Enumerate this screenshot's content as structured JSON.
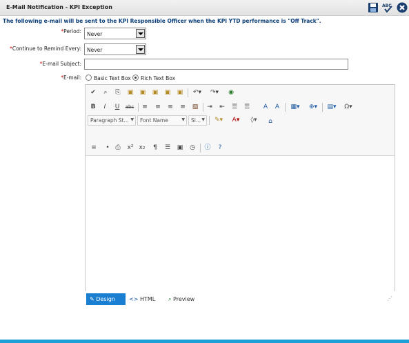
{
  "window": {
    "title": "E-Mail Notification - KPI Exception"
  },
  "info_text": "The following e-mail will be sent to the KPI Responsible Officer when the KPI YTD performance is \"Off Track\".",
  "form": {
    "period_label": "Period:",
    "period_value": "Never",
    "remind_label": "Continue to Remind Every:",
    "remind_value": "Never",
    "subject_label": "E-mail Subject:",
    "subject_value": "",
    "email_label": "E-mail:",
    "radio_basic": "Basic Text Box",
    "radio_rich": "Rich Text Box",
    "required_mark": "*"
  },
  "editor": {
    "paragraph_style": "Paragraph St...",
    "font_name": "Font Name",
    "font_size": "Si...",
    "bold": "B",
    "italic": "I",
    "underline": "U",
    "strike": "abc",
    "special_char": "Ω",
    "superscript": "x²",
    "subscript": "x₂",
    "modes": {
      "design": "Design",
      "html": "HTML",
      "preview": "Preview"
    }
  },
  "colors": {
    "accent": "#1a7fd1",
    "info_text": "#0a3e7a",
    "required": "#cc0000"
  }
}
